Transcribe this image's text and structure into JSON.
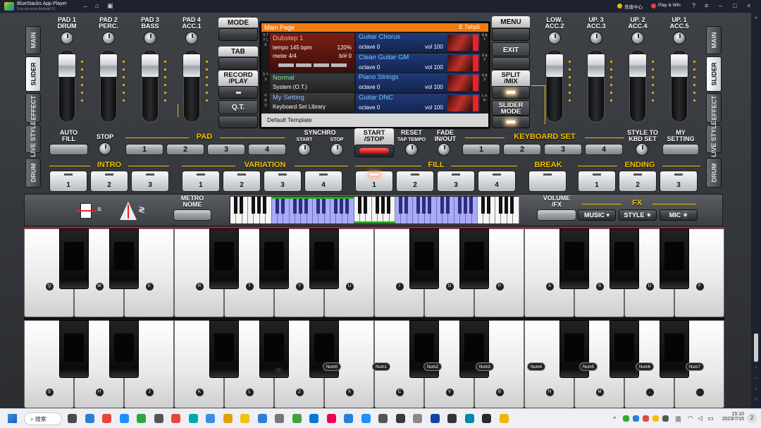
{
  "titlebar": {
    "app_name": "BlueStacks App Player",
    "version": "5.xx.xxx.xxxx Android 11",
    "right_1": "充值中心",
    "right_2": "Play & Win"
  },
  "left_tabs": [
    "MAIN",
    "SLIDER",
    "EFFECT",
    "LIVE STYLE",
    "DRUM"
  ],
  "right_tabs": [
    "MAIN",
    "SLIDER",
    "EFFECT",
    "LIVE STYLE",
    "DRUM"
  ],
  "left_sliders": [
    {
      "line1": "PAD 1",
      "line2": "DRUM"
    },
    {
      "line1": "PAD 2",
      "line2": "PERC."
    },
    {
      "line1": "PAD 3",
      "line2": "BASS"
    },
    {
      "line1": "PAD 4",
      "line2": "ACC.1"
    }
  ],
  "right_sliders": [
    {
      "line1": "LOW.",
      "line2": "ACC.2"
    },
    {
      "line1": "UP. 3",
      "line2": "ACC.3"
    },
    {
      "line1": "UP. 2",
      "line2": "ACC.4"
    },
    {
      "line1": "UP. 1",
      "line2": "ACC.5"
    }
  ],
  "left_buttons": {
    "mode": "MODE",
    "tab": "TAB",
    "record1": "RECORD",
    "record2": "/PLAY",
    "qt": "Q.T."
  },
  "right_buttons": {
    "menu": "MENU",
    "exit": "EXIT",
    "split1": "SPLIT",
    "split2": "/MIX",
    "slider1": "SLIDER",
    "slider2": "MODE"
  },
  "screen": {
    "header": "Main Page",
    "header_right": "E 7shp5",
    "style_name": "Dubstep 1",
    "tempo": "tempo 145 bpm",
    "tempo_pct": "120%",
    "meter": "meter 4/4",
    "key": "b/# 0",
    "sys_name": "Normal",
    "sys_sub": "System (O.T.)",
    "kbd_name": "My Setting",
    "kbd_sub": "Keyboard Set Library",
    "footer": "Default Template",
    "side_style": "S T Y L E",
    "side_sys": "S Y S",
    "side_kbd": "K B D",
    "voices": [
      {
        "name": "Guitar Chorus",
        "octave": "octave 0",
        "vol": "vol 100",
        "tag": "U p 1"
      },
      {
        "name": "Clean Guitar GM",
        "octave": "octave 0",
        "vol": "vol 100",
        "tag": "U p 2"
      },
      {
        "name": "Piano Strings",
        "octave": "octave 0",
        "vol": "vol 100",
        "tag": "U p 3"
      },
      {
        "name": "Guitar DNC",
        "octave": "octave 0",
        "vol": "vol 100",
        "tag": "L o w"
      }
    ]
  },
  "row2": {
    "auto_fill1": "AUTO",
    "auto_fill2": "FILL",
    "stop": "STOP",
    "pad": "PAD",
    "pads": [
      "1",
      "2",
      "3",
      "4"
    ],
    "synchro": "SYNCHRO",
    "start": "START",
    "stop2": "STOP",
    "start_stop1": "START",
    "start_stop2": "/STOP",
    "reset": "RESET",
    "tap_tempo": "TAP TEMPO",
    "fade1": "FADE",
    "fade2": "IN/OUT",
    "keyboard_set": "KEYBOARD SET",
    "kbd_sets": [
      "1",
      "2",
      "3",
      "4"
    ],
    "style_to1": "STYLE TO",
    "style_to2": "KBD SET",
    "my_setting1": "MY",
    "my_setting2": "SETTING"
  },
  "row3": {
    "intro": "INTRO",
    "intro_nums": [
      "1",
      "2",
      "3"
    ],
    "variation": "VARIATION",
    "var_nums": [
      "1",
      "2",
      "3",
      "4"
    ],
    "fill": "FILL",
    "fill_nums": [
      "1",
      "2",
      "3",
      "4"
    ],
    "break": "BREAK",
    "ending": "ENDING",
    "ending_nums": [
      "1",
      "2",
      "3"
    ]
  },
  "row4": {
    "metronome1": "METRO",
    "metronome2": "NOME",
    "volume1": "VOLUME",
    "volume2": "/FX",
    "fx": "FX",
    "music": "MUSIC",
    "style": "STYLE",
    "mic": "MIC"
  },
  "keys_upper": [
    "Q",
    "W",
    "E",
    "R",
    "T",
    "Y",
    "U",
    "I",
    "O",
    "P",
    "A",
    "S",
    "D",
    "F"
  ],
  "keys_lower": [
    "G",
    "H",
    "J",
    "K",
    "L",
    "Z",
    "X",
    "C",
    "V",
    "B",
    "N",
    "M",
    ",",
    "."
  ],
  "keys_upper_black": [],
  "keys_lower_black": [
    ";",
    "Num0",
    "Num1",
    "Num2",
    "Num3",
    "Num4",
    "Num5",
    "Num6",
    "Num7"
  ],
  "taskbar": {
    "search": "搜索",
    "time": "15:10",
    "date": "2023/7/15",
    "lang": "英"
  }
}
